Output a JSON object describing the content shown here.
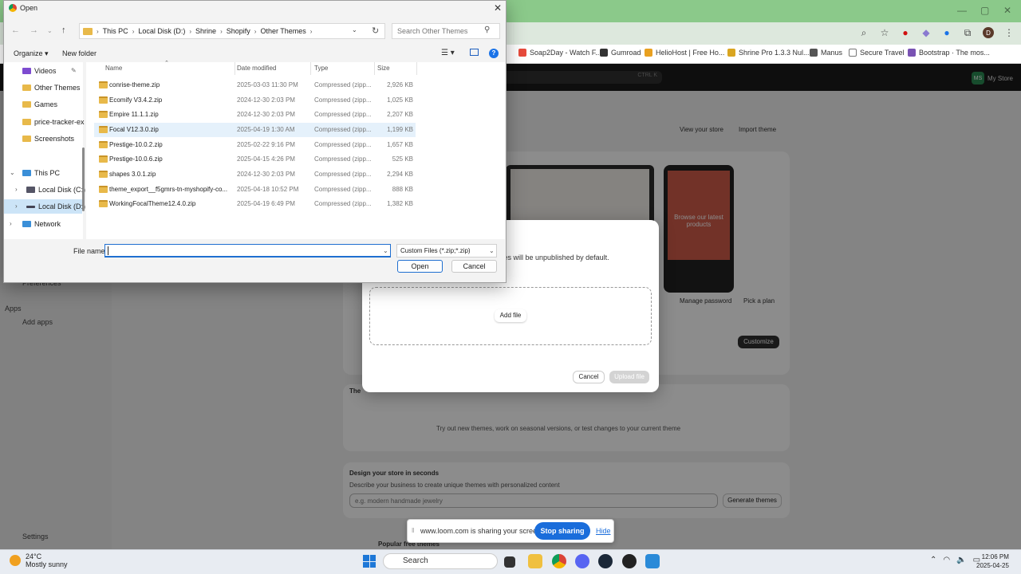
{
  "browser": {
    "win_min": "—",
    "win_max": "▢",
    "win_close": "✕",
    "bookmarks": [
      {
        "label": "Soap2Day - Watch F...",
        "color": "#e84b3c"
      },
      {
        "label": "Gumroad",
        "color": "#333333"
      },
      {
        "label": "HelioHost | Free Ho...",
        "color": "#e8a020"
      },
      {
        "label": "Shrine Pro 1.3.3 Nul...",
        "color": "#d9a520"
      },
      {
        "label": "Manus",
        "color": "#555555"
      },
      {
        "label": "Secure Travel",
        "color": "#777777"
      },
      {
        "label": "Bootstrap · The mos...",
        "color": "#7952b3"
      }
    ],
    "profile_initial": "D"
  },
  "shopify": {
    "search_shortcut": "CTRL K",
    "store_initials": "MS",
    "store_name": "My Store",
    "view_your_store": "View your store",
    "import_theme": "Import theme",
    "phone_text": "Browse our latest products",
    "manage_password": "Manage password",
    "pick_a_plan": "Pick a plan",
    "customize": "Customize",
    "themes_heading": "The",
    "themes_body": "Try out new themes, work on seasonal versions, or test changes to your current theme",
    "design_title": "Design your store in seconds",
    "design_sub": "Describe your business to create unique themes with personalized content",
    "design_placeholder": "e.g. modern handmade jewelry",
    "generate": "Generate themes",
    "popular": "Popular free themes",
    "sidebar": {
      "preferences": "Preferences",
      "apps": "Apps",
      "add_apps": "Add apps",
      "settings": "Settings"
    }
  },
  "upload_modal": {
    "note": "ded themes will be unpublished by default.",
    "add_file": "Add file",
    "cancel": "Cancel",
    "upload": "Upload file"
  },
  "loom": {
    "text": "www.loom.com is sharing your screen.",
    "stop": "Stop sharing",
    "hide": "Hide"
  },
  "dialog": {
    "title": "Open",
    "breadcrumb": [
      "This PC",
      "Local Disk (D:)",
      "Shrine",
      "Shopify",
      "Other Themes"
    ],
    "search_placeholder": "Search Other Themes",
    "organize": "Organize ▾",
    "new_folder": "New folder",
    "nav": {
      "videos": "Videos",
      "other_themes": "Other Themes",
      "games": "Games",
      "price_tracker": "price-tracker-ex",
      "screenshots": "Screenshots",
      "this_pc": "This PC",
      "local_c": "Local Disk (C:)",
      "local_d": "Local Disk (D:)",
      "network": "Network"
    },
    "columns": {
      "name": "Name",
      "date": "Date modified",
      "type": "Type",
      "size": "Size"
    },
    "files": [
      {
        "name": "conrise-theme.zip",
        "date": "2025-03-03 11:30 PM",
        "type": "Compressed (zipp...",
        "size": "2,926 KB"
      },
      {
        "name": "Ecomify V3.4.2.zip",
        "date": "2024-12-30 2:03 PM",
        "type": "Compressed (zipp...",
        "size": "1,025 KB"
      },
      {
        "name": "Empire 11.1.1.zip",
        "date": "2024-12-30 2:03 PM",
        "type": "Compressed (zipp...",
        "size": "2,207 KB"
      },
      {
        "name": "Focal V12.3.0.zip",
        "date": "2025-04-19 1:30 AM",
        "type": "Compressed (zipp...",
        "size": "1,199 KB"
      },
      {
        "name": "Prestige-10.0.2.zip",
        "date": "2025-02-22 9:16 PM",
        "type": "Compressed (zipp...",
        "size": "1,657 KB"
      },
      {
        "name": "Prestige-10.0.6.zip",
        "date": "2025-04-15 4:26 PM",
        "type": "Compressed (zipp...",
        "size": "525 KB"
      },
      {
        "name": "shapes 3.0.1.zip",
        "date": "2024-12-30 2:03 PM",
        "type": "Compressed (zipp...",
        "size": "2,294 KB"
      },
      {
        "name": "theme_export__f5gmrs-tn-myshopify-co...",
        "date": "2025-04-18 10:52 PM",
        "type": "Compressed (zipp...",
        "size": "888 KB"
      },
      {
        "name": "WorkingFocalTheme12.4.0.zip",
        "date": "2025-04-19 6:49 PM",
        "type": "Compressed (zipp...",
        "size": "1,382 KB"
      }
    ],
    "filename_label": "File name:",
    "filename_value": "",
    "filter": "Custom Files (*.zip;*.zip)",
    "open": "Open",
    "cancel": "Cancel"
  },
  "taskbar": {
    "temp": "24°C",
    "weather": "Mostly sunny",
    "search": "Search",
    "time": "12:06 PM",
    "date": "2025-04-25"
  }
}
